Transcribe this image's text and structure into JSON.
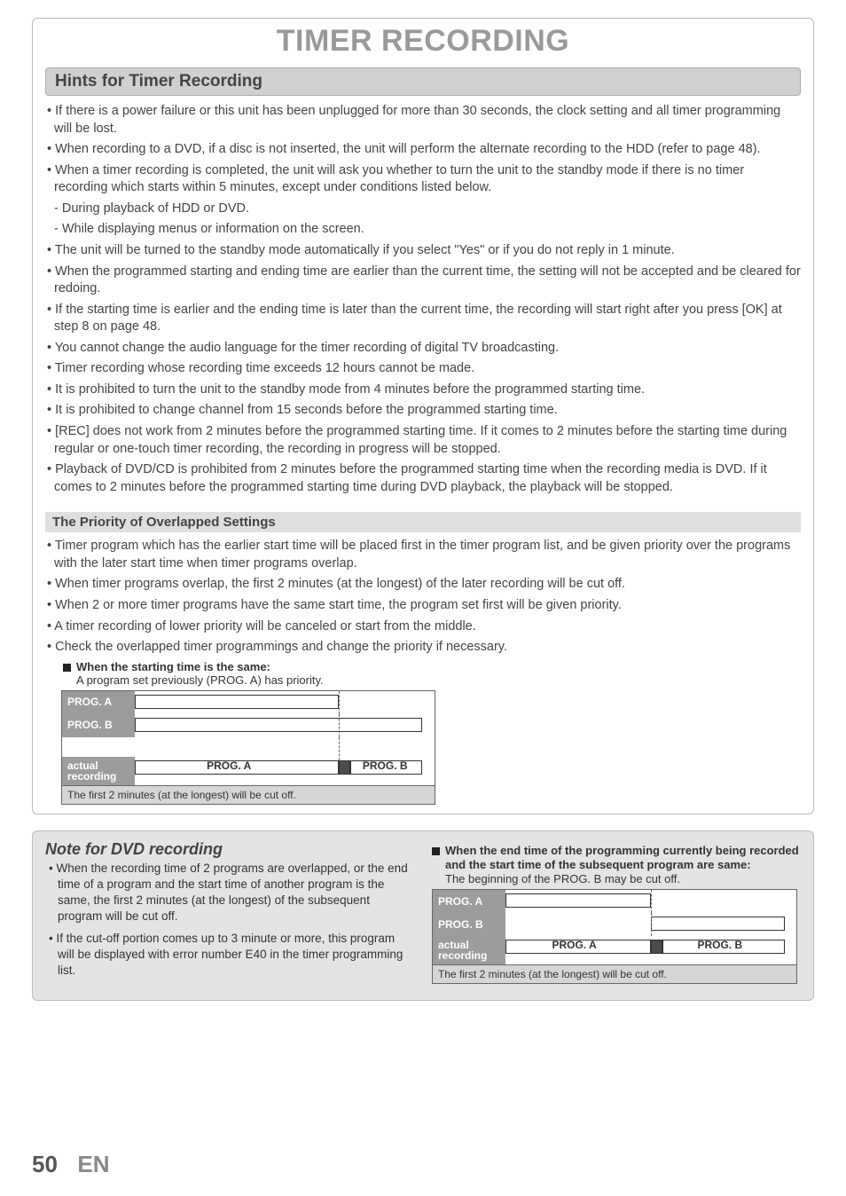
{
  "title": "TIMER RECORDING",
  "section1_title": "Hints for Timer Recording",
  "hints": [
    "• If there is a power failure or this unit has been unplugged for more than 30 seconds, the clock setting and all timer programming will be lost.",
    "• When recording to a DVD, if a disc is not inserted, the unit will perform the alternate recording to the HDD (refer to page 48).",
    "• When a timer recording is completed, the unit will ask you whether to turn the unit to the standby mode if there is no timer recording which starts within 5 minutes, except under conditions listed below.",
    "- During playback of HDD or DVD.",
    "- While displaying menus or information on the screen.",
    "• The unit will be turned to the standby mode automatically if you select \"Yes\" or if you do not reply in 1 minute.",
    "• When the programmed starting and ending time are earlier than the current time, the setting will not be accepted and be cleared for redoing.",
    "• If the starting time is earlier and the ending time is later than the current time, the recording will start right after you press [OK] at step 8 on page 48.",
    "• You cannot change the audio language for the timer recording of digital TV broadcasting.",
    "• Timer recording whose recording time exceeds 12 hours cannot be made.",
    "• It is prohibited to turn the unit to the standby mode from 4 minutes before the programmed starting time.",
    "• It is prohibited to change channel from 15 seconds before the programmed starting time.",
    "• [REC] does not work from 2 minutes before the programmed starting time. If it comes to 2 minutes before the starting time during regular or one-touch timer recording, the recording in progress will be stopped.",
    "• Playback of DVD/CD is prohibited from 2 minutes before the programmed starting time when the recording media is DVD. If it comes to 2 minutes before the programmed starting time during DVD playback, the playback will be stopped."
  ],
  "sub_bar": "The Priority of Overlapped Settings",
  "priority": [
    "• Timer program which has the earlier start time will be placed first in the timer program list, and be given priority over the programs with the later start time when timer programs overlap.",
    "• When timer programs overlap, the first 2 minutes (at the longest) of the later recording will be cut off.",
    "• When 2 or more timer programs have the same start time, the program set first will be given priority.",
    "• A timer recording of lower priority will be canceled or start from the middle.",
    "• Check the overlapped timer programmings and change the priority if necessary."
  ],
  "legend1_title": "When the starting time is the same:",
  "legend1_sub": "A program set previously (PROG. A) has priority.",
  "box_labels": {
    "prog_a": "PROG. A",
    "prog_b": "PROG. B",
    "actual": "actual recording"
  },
  "box_caption": "The first 2 minutes (at the longest) will be cut off.",
  "note_title": "Note for DVD recording",
  "note_bullets": [
    "•  When the recording time of 2 programs are overlapped, or the end time of a program and the start time of another program is the same, the first 2 minutes (at the longest) of the subsequent program will be cut off.",
    "•  If the cut-off portion comes up to 3 minute or more, this program will be displayed with error number E40 in the timer programming list."
  ],
  "legend2_title": "When the end time of the programming currently being recorded and the start time of the subsequent program are same:",
  "legend2_sub": "The beginning of the PROG. B may be cut off.",
  "footer": {
    "page": "50",
    "lang": "EN"
  }
}
